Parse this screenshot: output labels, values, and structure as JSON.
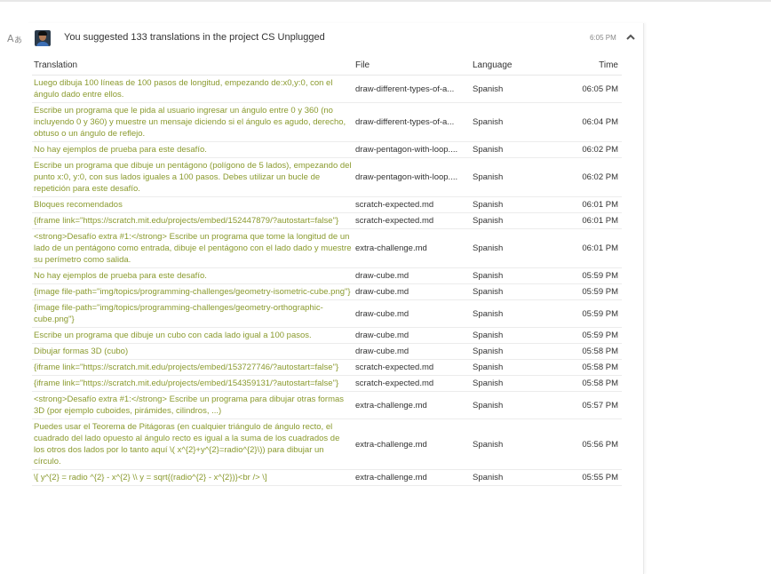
{
  "activity": {
    "summary_prefix": "You suggested 133 translations in the project ",
    "project": "CS Unplugged",
    "time": "6:05 PM"
  },
  "columns": {
    "translation": "Translation",
    "file": "File",
    "language": "Language",
    "time": "Time"
  },
  "rows": [
    {
      "translation": "Luego dibuja 100 líneas de 100 pasos de longitud, empezando de:x0,y:0, con el ángulo dado entre ellos.",
      "file": "draw-different-types-of-a...",
      "language": "Spanish",
      "time": "06:05 PM"
    },
    {
      "translation": "Escribe un programa que le pida al usuario ingresar un ángulo entre 0 y 360 (no incluyendo 0 y 360) y muestre un mensaje diciendo si el ángulo es agudo, derecho, obtuso o un ángulo de reflejo.",
      "file": "draw-different-types-of-a...",
      "language": "Spanish",
      "time": "06:04 PM"
    },
    {
      "translation": "No hay ejemplos de prueba para este desafío.",
      "file": "draw-pentagon-with-loop....",
      "language": "Spanish",
      "time": "06:02 PM"
    },
    {
      "translation": "Escribe un programa que dibuje un pentágono (polígono de 5 lados), empezando del punto x:0, y:0, con sus lados iguales a 100 pasos. Debes utilizar un bucle de repetición para este desafío.",
      "file": "draw-pentagon-with-loop....",
      "language": "Spanish",
      "time": "06:02 PM"
    },
    {
      "translation": "Bloques recomendados",
      "file": "scratch-expected.md",
      "language": "Spanish",
      "time": "06:01 PM"
    },
    {
      "translation": "{iframe link=\"https://scratch.mit.edu/projects/embed/152447879/?autostart=false\"}",
      "file": "scratch-expected.md",
      "language": "Spanish",
      "time": "06:01 PM"
    },
    {
      "translation": "<strong>Desafío extra #1:</strong> Escribe un programa que tome la longitud de un lado de un pentágono como entrada, dibuje el pentágono con el lado dado y muestre su perímetro como salida.",
      "file": "extra-challenge.md",
      "language": "Spanish",
      "time": "06:01 PM"
    },
    {
      "translation": "No hay ejemplos de prueba para este desafío.",
      "file": "draw-cube.md",
      "language": "Spanish",
      "time": "05:59 PM"
    },
    {
      "translation": "{image file-path=\"img/topics/programming-challenges/geometry-isometric-cube.png\"}",
      "file": "draw-cube.md",
      "language": "Spanish",
      "time": "05:59 PM"
    },
    {
      "translation": "{image file-path=\"img/topics/programming-challenges/geometry-orthographic-cube.png\"}",
      "file": "draw-cube.md",
      "language": "Spanish",
      "time": "05:59 PM"
    },
    {
      "translation": "Escribe un programa que dibuje un cubo con cada lado igual a 100 pasos.",
      "file": "draw-cube.md",
      "language": "Spanish",
      "time": "05:59 PM"
    },
    {
      "translation": "Dibujar formas 3D (cubo)",
      "file": "draw-cube.md",
      "language": "Spanish",
      "time": "05:58 PM"
    },
    {
      "translation": "{iframe link=\"https://scratch.mit.edu/projects/embed/153727746/?autostart=false\"}",
      "file": "scratch-expected.md",
      "language": "Spanish",
      "time": "05:58 PM"
    },
    {
      "translation": "{iframe link=\"https://scratch.mit.edu/projects/embed/154359131/?autostart=false\"}",
      "file": "scratch-expected.md",
      "language": "Spanish",
      "time": "05:58 PM"
    },
    {
      "translation": "<strong>Desafío extra #1:</strong> Escribe un programa para dibujar otras formas 3D (por ejemplo cuboides, pirámides, cilindros, ...)",
      "file": "extra-challenge.md",
      "language": "Spanish",
      "time": "05:57 PM"
    },
    {
      "translation": "Puedes usar el Teorema de Pitágoras (en cualquier triángulo de ángulo recto, el cuadrado del lado opuesto al ángulo recto es igual a la suma de los cuadrados de los otros dos lados por lo tanto aquí \\( x^{2}+y^{2}=radio^{2}\\)) para dibujar un círculo.",
      "file": "extra-challenge.md",
      "language": "Spanish",
      "time": "05:56 PM"
    },
    {
      "translation": "\\[ y^{2} = radio ^{2} - x^{2} \\\\ y = sqrt{(radio^{2} - x^{2})}<br /> \\]",
      "file": "extra-challenge.md",
      "language": "Spanish",
      "time": "05:55 PM"
    }
  ]
}
